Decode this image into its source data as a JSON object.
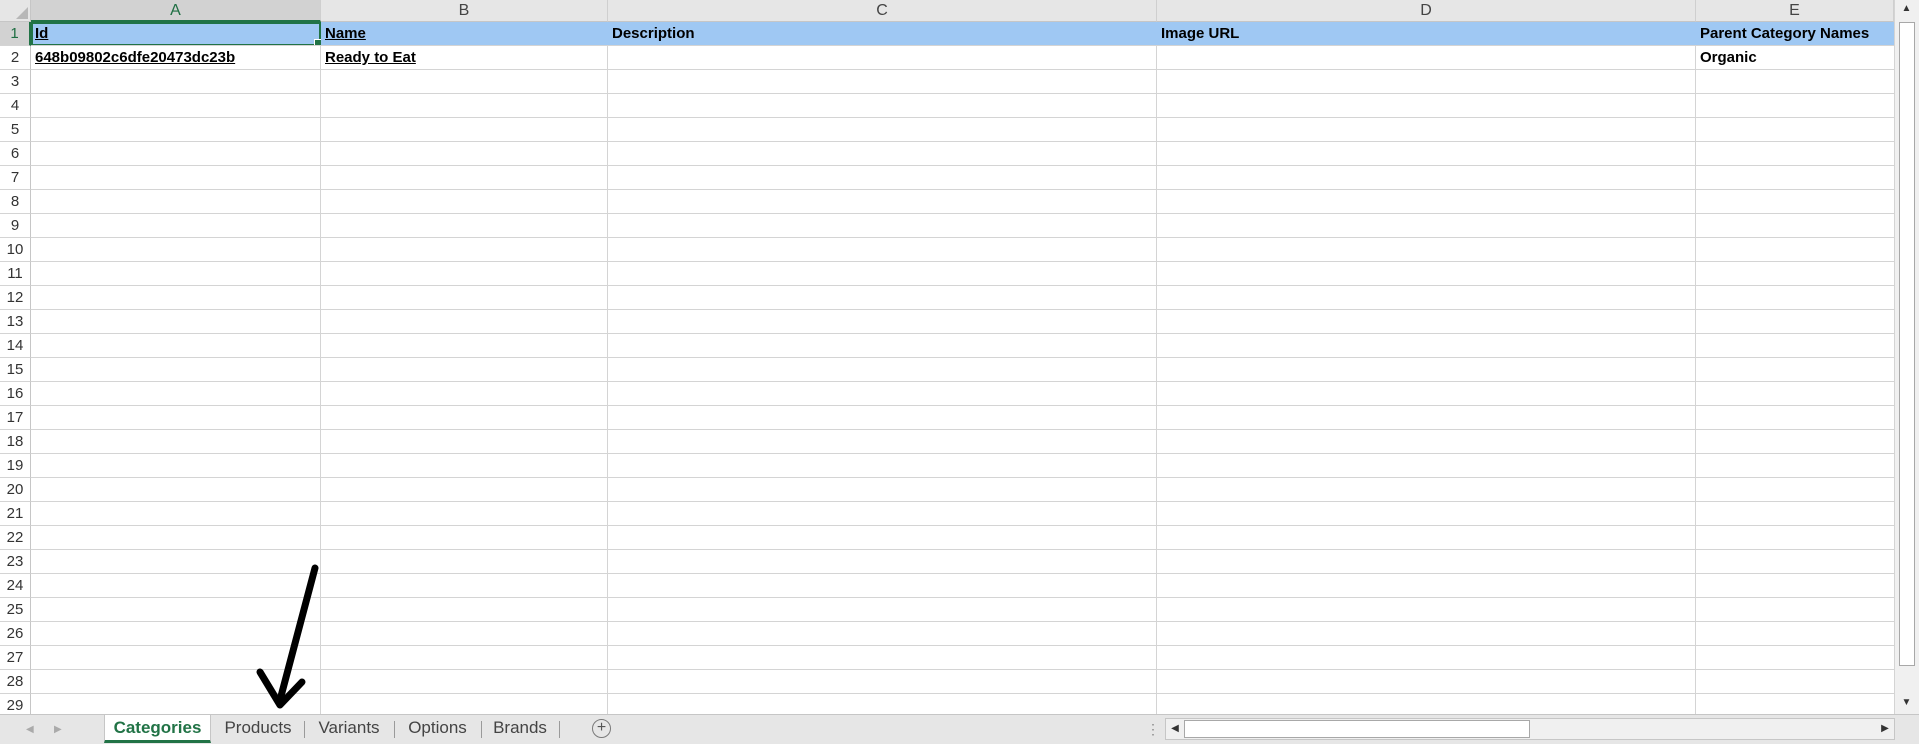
{
  "columns": [
    "A",
    "B",
    "C",
    "D",
    "E"
  ],
  "rows": [
    "1",
    "2",
    "3",
    "4",
    "5",
    "6",
    "7",
    "8",
    "9",
    "10",
    "11",
    "12",
    "13",
    "14",
    "15",
    "16",
    "17",
    "18",
    "19",
    "20",
    "21",
    "22",
    "23",
    "24",
    "25",
    "26",
    "27",
    "28",
    "29"
  ],
  "header_row": {
    "id": "Id",
    "name": "Name",
    "description": "Description",
    "image_url": "Image URL",
    "parent_category_names": "Parent Category Names"
  },
  "data_row": {
    "id": "648b09802c6dfe20473dc23b",
    "name": "Ready to Eat",
    "description": "",
    "image_url": "",
    "parent_category_names": "Organic"
  },
  "sheet_tabs": [
    "Categories",
    "Products",
    "Variants",
    "Options",
    "Brands"
  ],
  "active_tab": "Categories",
  "colors": {
    "header_fill": "#9fc8f3",
    "accent": "#217346",
    "grid_line": "#d4d4d4"
  },
  "icons": {
    "add_sheet": "plus-circle-icon",
    "annotation": "arrow-pointer-icon"
  }
}
